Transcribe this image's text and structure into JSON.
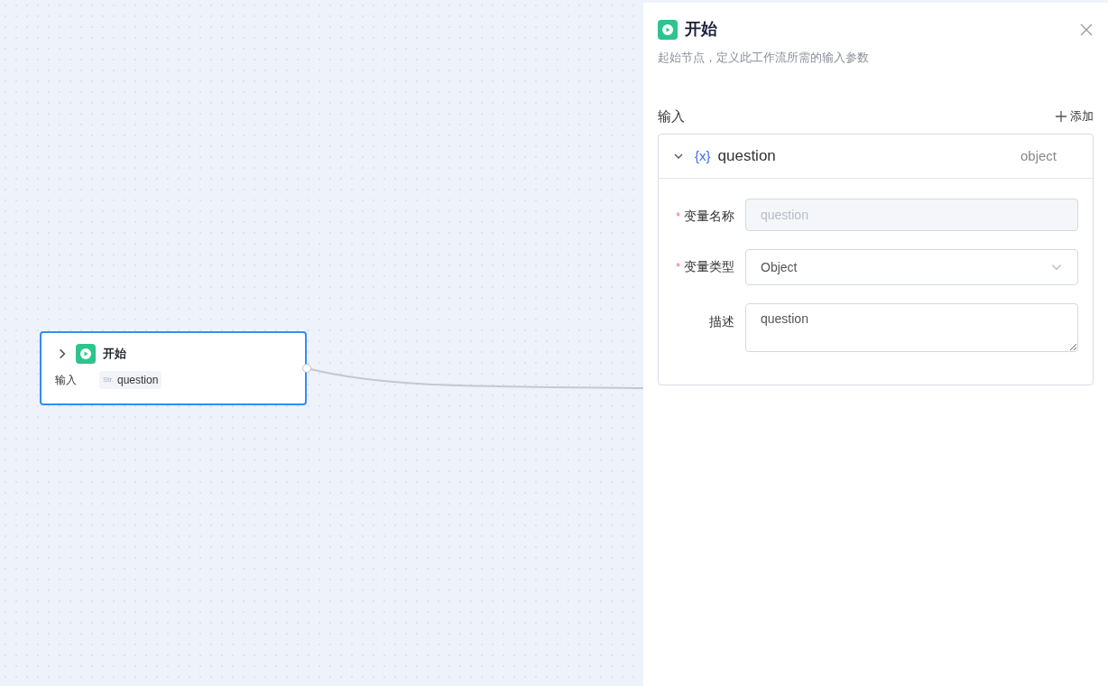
{
  "canvas": {
    "node": {
      "title": "开始",
      "expanded": false,
      "selected": true,
      "input_label": "输入",
      "inputs": [
        {
          "type_tag": "Str.",
          "name": "question"
        }
      ]
    }
  },
  "panel": {
    "title": "开始",
    "description": "起始节点，定义此工作流所需的输入参数",
    "section_label": "输入",
    "add_button": "添加",
    "variables": [
      {
        "icon_text": "{x}",
        "name": "question",
        "type": "object",
        "expanded": true,
        "fields": [
          {
            "kind": "input",
            "label": "变量名称",
            "required_mark": "*",
            "disabled": true,
            "value": "question"
          },
          {
            "kind": "select",
            "label": "变量类型",
            "required_mark": "*",
            "disabled": false,
            "value": "Object"
          },
          {
            "kind": "textarea",
            "label": "描述",
            "disabled": false,
            "value": "question"
          }
        ]
      }
    ]
  }
}
